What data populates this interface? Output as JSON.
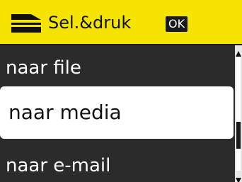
{
  "header": {
    "title": "Sel.&druk",
    "ok_label": "OK",
    "icon": "scan-icon",
    "background": "#f5e300"
  },
  "menu": {
    "items": [
      {
        "label": "naar file",
        "selected": false
      },
      {
        "label": "naar media",
        "selected": true
      },
      {
        "label": "naar e-mail",
        "selected": false
      }
    ],
    "selected_background": "#ffffff",
    "background": "#2b2b2b"
  },
  "scrollbar": {
    "position_fraction": 0.75,
    "thumb_color": "#1a1a1a"
  }
}
